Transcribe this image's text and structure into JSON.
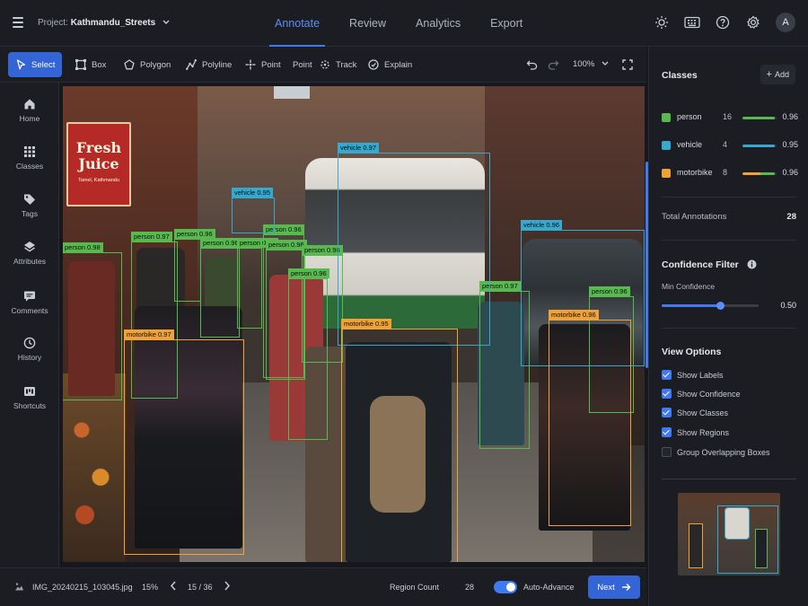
{
  "header": {
    "project_prefix": "Project:",
    "project_name": "Kathmandu_Streets",
    "tabs": [
      {
        "label": "Annotate",
        "active": true
      },
      {
        "label": "Review",
        "active": false
      },
      {
        "label": "Analytics",
        "active": false
      },
      {
        "label": "Export",
        "active": false
      }
    ],
    "avatar_initial": "A",
    "icons": [
      "menu-icon",
      "sun-icon",
      "keyboard-icon",
      "help-icon",
      "gear-icon"
    ]
  },
  "toolbar": {
    "tools": [
      {
        "label": "Select",
        "icon": "cursor-icon",
        "active": true
      },
      {
        "label": "Box",
        "icon": "box-icon"
      },
      {
        "label": "Polygon",
        "icon": "polygon-icon"
      },
      {
        "label": "Polyline",
        "icon": "polyline-icon"
      },
      {
        "label": "Point",
        "icon": "point-icon"
      },
      {
        "label": "Point",
        "icon": ""
      },
      {
        "label": "Track",
        "icon": "track-icon"
      },
      {
        "label": "Explain",
        "icon": "explain-icon"
      }
    ],
    "zoom": "100%"
  },
  "sidebar": {
    "items": [
      {
        "label": "Home",
        "icon": "home-icon"
      },
      {
        "label": "Classes",
        "icon": "grid-icon"
      },
      {
        "label": "Tags",
        "icon": "tag-icon"
      },
      {
        "label": "Attributes",
        "icon": "layers-icon"
      },
      {
        "label": "Comments",
        "icon": "comment-icon"
      },
      {
        "label": "History",
        "icon": "history-icon"
      },
      {
        "label": "Shortcuts",
        "icon": "shortcuts-icon"
      }
    ]
  },
  "canvas": {
    "sign_line1": "Fresh",
    "sign_line2": "Juice",
    "sign_sub": "Tamel, Kathmandu",
    "annotations": [
      {
        "cls": "person",
        "label": "person 0.98"
      },
      {
        "cls": "person",
        "label": "person 0.97"
      },
      {
        "cls": "person",
        "label": "person 0.96"
      },
      {
        "cls": "person",
        "label": "person 0.96"
      },
      {
        "cls": "person",
        "label": "person 0.96"
      },
      {
        "cls": "person",
        "label": "person 0.96"
      },
      {
        "cls": "person",
        "label": "person 0.96"
      },
      {
        "cls": "person",
        "label": "person 0.96"
      },
      {
        "cls": "person",
        "label": "person 0.97"
      },
      {
        "cls": "person",
        "label": "person 0.96"
      },
      {
        "cls": "vehicle",
        "label": "vehicle 0.97"
      },
      {
        "cls": "vehicle",
        "label": "vehicle 0.95"
      },
      {
        "cls": "vehicle",
        "label": "vehicle 0.96"
      },
      {
        "cls": "motorbike",
        "label": "motorbike 0.97"
      },
      {
        "cls": "motorbike",
        "label": "motorbike 0.95"
      },
      {
        "cls": "motorbike",
        "label": "motorbike 0.96"
      }
    ]
  },
  "classes_panel": {
    "title": "Classes",
    "add_label": "Add",
    "classes": [
      {
        "name": "person",
        "count": "16",
        "confidence": "0.96",
        "color": "#58b94f",
        "bar_fraction": 0.96
      },
      {
        "name": "vehicle",
        "count": "4",
        "confidence": "0.95",
        "color": "#35a9cf",
        "bar_fraction": 0.95
      },
      {
        "name": "motorbike",
        "count": "8",
        "confidence": "0.96",
        "color": "#f0a235",
        "bar_fraction": 0.96
      }
    ],
    "total_label": "Total Annotations",
    "total_value": "28"
  },
  "confidence_filter": {
    "title": "Confidence Filter",
    "min_label": "Min Confidence",
    "min_value": "0.50",
    "slider_fraction": 0.6
  },
  "view_options": {
    "title": "View Options",
    "options": [
      {
        "label": "Show Labels",
        "checked": true
      },
      {
        "label": "Show Confidence",
        "checked": true
      },
      {
        "label": "Show Classes",
        "checked": true
      },
      {
        "label": "Show Regions",
        "checked": true
      },
      {
        "label": "Group Overlapping Boxes",
        "checked": false
      }
    ]
  },
  "footer": {
    "filename": "IMG_20240215_103045.jpg",
    "zoom_short": "15%",
    "page": "15 / 36",
    "region_count_label": "Region Count",
    "region_count_value": "28",
    "auto_advance_label": "Auto-Advance",
    "next_label": "Next"
  }
}
